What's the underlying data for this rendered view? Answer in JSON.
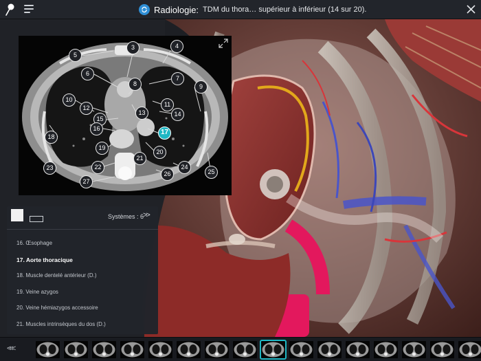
{
  "header": {
    "title": "Radiologie:",
    "subtitle": "TDM du thora…  supérieur à inférieur (14 sur 20)."
  },
  "ct": {
    "labels": [
      "3",
      "4",
      "5",
      "6",
      "7",
      "8",
      "9",
      "10",
      "11",
      "12",
      "13",
      "14",
      "15",
      "16",
      "17",
      "18",
      "19",
      "20",
      "21",
      "22",
      "23",
      "24",
      "25",
      "26",
      "27"
    ],
    "active_label": "17"
  },
  "panel": {
    "systems_label": "Systèmes : 6",
    "items": [
      {
        "label": "16. Œsophage",
        "active": false
      },
      {
        "label": "17. Aorte thoracique",
        "active": true
      },
      {
        "label": "18. Muscle dentelé antérieur (D.)",
        "active": false
      },
      {
        "label": "19. Veine azygos",
        "active": false
      },
      {
        "label": "20. Veine hémiazygos accessoire",
        "active": false
      },
      {
        "label": "21. Muscles intrinsèques du dos (D.)",
        "active": false
      }
    ]
  },
  "strip": {
    "slice_count": 16,
    "active_index": 8
  },
  "colors": {
    "accent": "#1fb7c4",
    "radiology_icon": "#2f8fd6"
  },
  "icons": [
    "pin-icon",
    "menu-icon",
    "radiology-icon",
    "close-icon",
    "expand-icon",
    "chevron-right-icon",
    "double-chevron-left-icon"
  ]
}
